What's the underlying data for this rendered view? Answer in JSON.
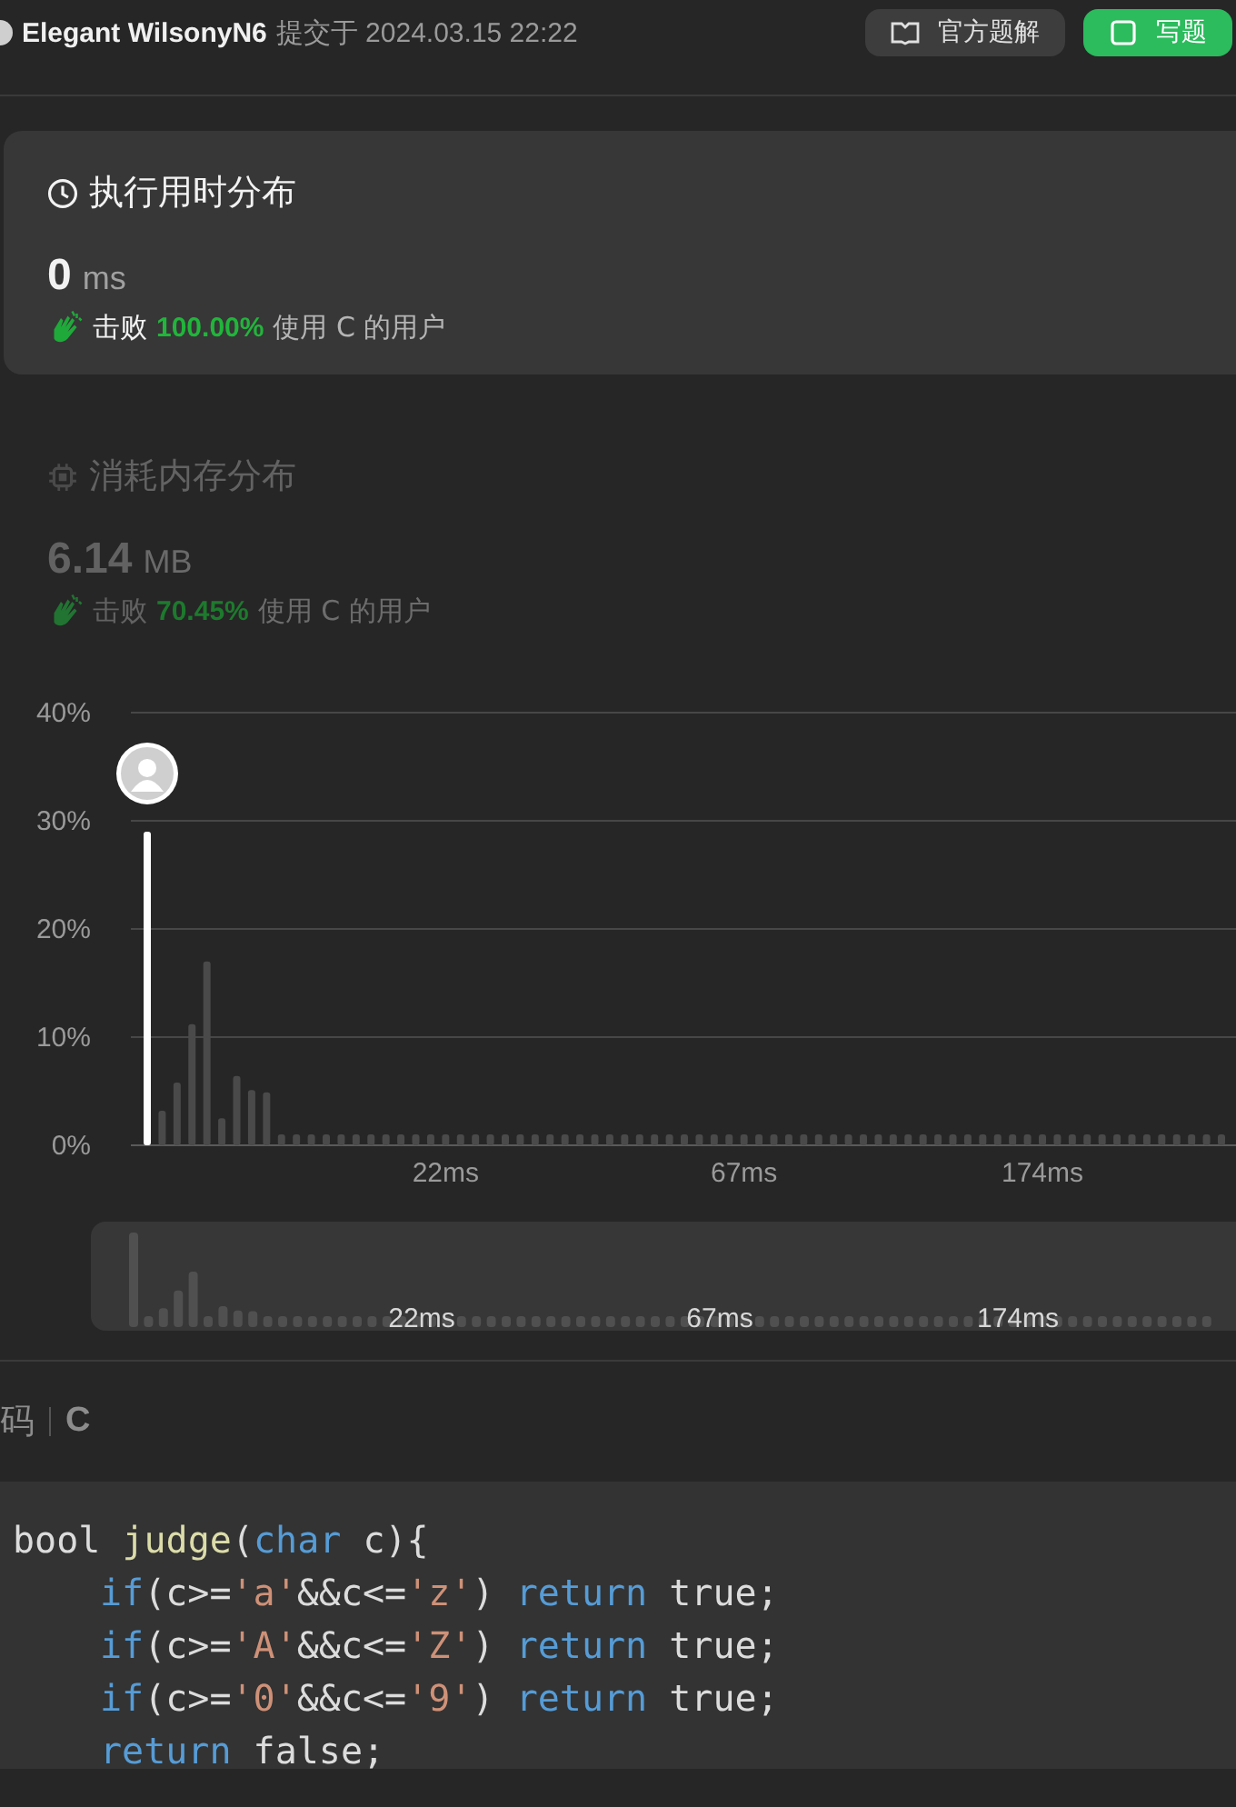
{
  "submission": {
    "user": "Elegant WilsonyN6",
    "submitted": "提交于 2024.03.15 22:22"
  },
  "actions": [
    {
      "label": "官方题解",
      "kind": "secondary"
    },
    {
      "label": "写题",
      "kind": "primary"
    }
  ],
  "runtime": {
    "title": "执行用时分布",
    "selected": true,
    "value": "0",
    "unit": "ms",
    "beats": "击败",
    "percent": "100.00%",
    "suffix": "使用 C 的用户"
  },
  "memory": {
    "title": "消耗内存分布",
    "selected": false,
    "value": "6.14",
    "unit": "MB",
    "beats": "击败",
    "percent": "70.45%",
    "suffix": "使用 C 的用户"
  },
  "chart_data": {
    "type": "bar",
    "stacked": true,
    "grid": true,
    "categories": [
      null,
      null,
      null,
      null,
      null,
      null,
      null,
      null,
      null,
      null,
      null,
      null,
      null,
      null,
      null,
      null,
      null,
      null,
      null,
      null,
      "22ms",
      null,
      null,
      null,
      null,
      null,
      null,
      null,
      null,
      null,
      null,
      null,
      null,
      null,
      null,
      null,
      null,
      null,
      null,
      null,
      "67ms",
      null,
      null,
      null,
      null,
      null,
      null,
      null,
      null,
      null,
      null,
      null,
      null,
      null,
      null,
      null,
      null,
      null,
      null,
      null,
      "174ms",
      null,
      null,
      null,
      null,
      null,
      null,
      null,
      null,
      null,
      null,
      null,
      null
    ],
    "ylim": [
      0,
      40
    ],
    "yticks": [
      {
        "value": 0,
        "label": "0%"
      },
      {
        "value": 10,
        "label": "10%"
      },
      {
        "value": 20,
        "label": "20%"
      },
      {
        "value": 30,
        "label": "30%"
      },
      {
        "value": 40,
        "label": "40%"
      }
    ],
    "series": [
      {
        "color": "#ffffff",
        "values": [
          29,
          null,
          null,
          null,
          null,
          null,
          null,
          null,
          null,
          null,
          null,
          null,
          null,
          null,
          null,
          null,
          null,
          null,
          null,
          null,
          null,
          null,
          null,
          null,
          null,
          null,
          null,
          null,
          null,
          null,
          null,
          null,
          null,
          null,
          null,
          null,
          null,
          null,
          null,
          null,
          null,
          null,
          null,
          null,
          null,
          null,
          null,
          null,
          null,
          null,
          null,
          null,
          null,
          null,
          null,
          null,
          null,
          null,
          null,
          null,
          null,
          null,
          null,
          null,
          null,
          null,
          null,
          null,
          null,
          null,
          null,
          null,
          null
        ]
      },
      {
        "color": "#4a4a4a",
        "values": [
          null,
          3.2,
          5.8,
          11.2,
          17,
          2.5,
          6.4,
          5.1,
          4.9,
          1,
          1,
          1,
          1,
          1,
          1,
          1,
          1,
          1,
          1,
          1,
          1,
          1,
          1,
          1,
          1,
          1,
          1,
          1,
          1,
          1,
          1,
          1,
          1,
          1,
          1,
          1,
          1,
          1,
          1,
          1,
          1,
          1,
          1,
          1,
          1,
          1,
          1,
          1,
          1,
          1,
          1,
          1,
          1,
          1,
          1,
          1,
          1,
          1,
          1,
          1,
          1,
          1,
          1,
          1,
          1,
          1,
          1,
          1,
          1,
          1,
          1,
          1,
          1
        ]
      }
    ]
  },
  "overview": {
    "labels": [
      "22ms",
      "67ms",
      "174ms"
    ]
  },
  "code": {
    "title": "码",
    "language": "C",
    "lines": [
      {
        "indented": false,
        "tokens": [
          {
            "text": "bool ",
            "kind": "plain"
          },
          {
            "text": "judge",
            "kind": "func"
          },
          {
            "text": "(",
            "kind": "plain"
          },
          {
            "text": "char",
            "kind": "keyword"
          },
          {
            "text": " c){",
            "kind": "plain"
          }
        ]
      },
      {
        "indented": true,
        "tokens": [
          {
            "text": "if",
            "kind": "keyword"
          },
          {
            "text": "(c>=",
            "kind": "plain"
          },
          {
            "text": "'a'",
            "kind": "string"
          },
          {
            "text": "&&c<=",
            "kind": "plain"
          },
          {
            "text": "'z'",
            "kind": "string"
          },
          {
            "text": ") ",
            "kind": "plain"
          },
          {
            "text": "return",
            "kind": "keyword"
          },
          {
            "text": " true;",
            "kind": "plain"
          }
        ]
      },
      {
        "indented": true,
        "tokens": [
          {
            "text": "if",
            "kind": "keyword"
          },
          {
            "text": "(c>=",
            "kind": "plain"
          },
          {
            "text": "'A'",
            "kind": "string"
          },
          {
            "text": "&&c<=",
            "kind": "plain"
          },
          {
            "text": "'Z'",
            "kind": "string"
          },
          {
            "text": ") ",
            "kind": "plain"
          },
          {
            "text": "return",
            "kind": "keyword"
          },
          {
            "text": " true;",
            "kind": "plain"
          }
        ]
      },
      {
        "indented": true,
        "tokens": [
          {
            "text": "if",
            "kind": "keyword"
          },
          {
            "text": "(c>=",
            "kind": "plain"
          },
          {
            "text": "'0'",
            "kind": "string"
          },
          {
            "text": "&&c<=",
            "kind": "plain"
          },
          {
            "text": "'9'",
            "kind": "string"
          },
          {
            "text": ") ",
            "kind": "plain"
          },
          {
            "text": "return",
            "kind": "keyword"
          },
          {
            "text": " true;",
            "kind": "plain"
          }
        ]
      },
      {
        "indented": true,
        "tokens": [
          {
            "text": "return",
            "kind": "keyword"
          },
          {
            "text": " false;",
            "kind": "plain"
          }
        ]
      }
    ]
  }
}
